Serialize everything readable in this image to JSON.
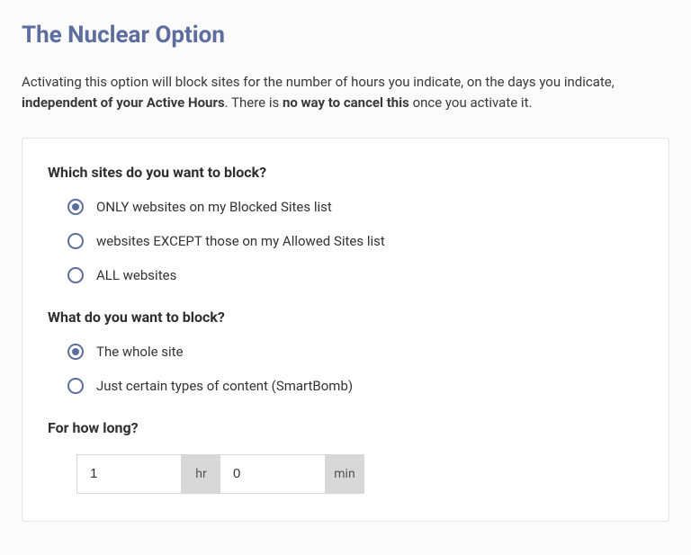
{
  "title": "The Nuclear Option",
  "intro": {
    "part1": "Activating this option will block sites for the number of hours you indicate, on the days you indicate, ",
    "bold1": "independent of your Active Hours",
    "part2": ". There is ",
    "bold2": "no way to cancel this",
    "part3": " once you activate it."
  },
  "q1": {
    "question": "Which sites do you want to block?",
    "options": [
      {
        "label": "ONLY websites on my Blocked Sites list",
        "selected": true
      },
      {
        "label": "websites EXCEPT those on my Allowed Sites list",
        "selected": false
      },
      {
        "label": "ALL websites",
        "selected": false
      }
    ]
  },
  "q2": {
    "question": "What do you want to block?",
    "options": [
      {
        "label": "The whole site",
        "selected": true
      },
      {
        "label": "Just certain types of content (SmartBomb)",
        "selected": false
      }
    ]
  },
  "q3": {
    "question": "For how long?",
    "hours": "1",
    "hr_label": "hr",
    "minutes": "0",
    "min_label": "min"
  }
}
